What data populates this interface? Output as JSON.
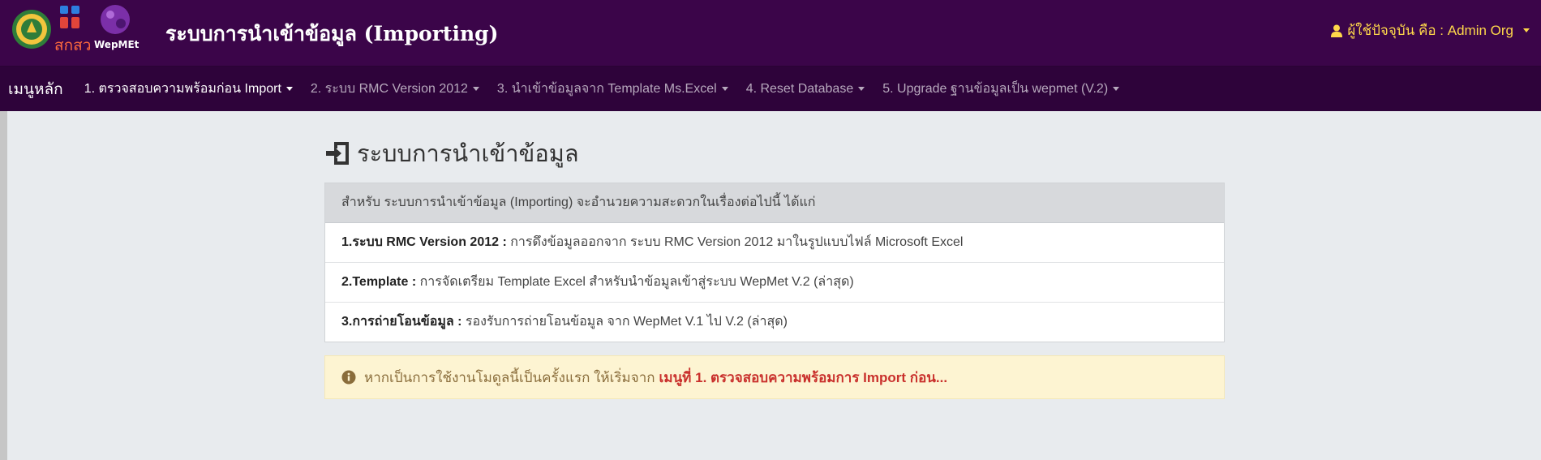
{
  "header": {
    "logo_text_1": "สกสว",
    "logo_text_2": "WepMEt",
    "title": "ระบบการนำเข้าข้อมูล (Importing)",
    "user_label": "ผู้ใช้ปัจจุบัน คือ : Admin Org"
  },
  "nav": {
    "brand": "เมนูหลัก",
    "items": [
      {
        "label": "1. ตรวจสอบความพร้อมก่อน Import"
      },
      {
        "label": "2. ระบบ RMC Version 2012"
      },
      {
        "label": "3. นำเข้าข้อมูลจาก Template Ms.Excel"
      },
      {
        "label": "4. Reset Database"
      },
      {
        "label": "5. Upgrade ฐานข้อมูลเป็น wepmet (V.2)"
      }
    ]
  },
  "main": {
    "heading": "ระบบการนำเข้าข้อมูล",
    "panel": {
      "header": "สำหรับ ระบบการนำเข้าข้อมูล (Importing) จะอำนวยความสะดวกในเรื่องต่อไปนี้ ได้แก่",
      "rows": [
        {
          "title": "1.ระบบ RMC Version 2012 :",
          "text": " การดึงข้อมูลออกจาก ระบบ RMC Version 2012 มาในรูปแบบไฟล์ Microsoft Excel"
        },
        {
          "title": "2.Template :",
          "text": " การจัดเตรียม Template Excel สำหรับนำข้อมูลเข้าสู่ระบบ WepMet V.2 (ล่าสุด)"
        },
        {
          "title": "3.การถ่ายโอนข้อมูล :",
          "text": " รองรับการถ่ายโอนข้อมูล จาก WepMet V.1 ไป V.2 (ล่าสุด)"
        }
      ]
    },
    "alert": {
      "text": "หากเป็นการใช้งานโมดูลนี้เป็นครั้งแรก ให้เริ่มจาก",
      "emphasis": "เมนูที่ 1. ตรวจสอบความพร้อมการ Import ก่อน..."
    }
  },
  "colors": {
    "header_bg": "#3b0549",
    "nav_bg": "#2e033a",
    "user_text": "#ffd84a",
    "alert_bg": "#fdf4d2",
    "alert_emphasis": "#c9302c"
  },
  "icons": {
    "user": "user-icon",
    "heading": "sign-in-icon",
    "alert": "info-circle-icon"
  }
}
